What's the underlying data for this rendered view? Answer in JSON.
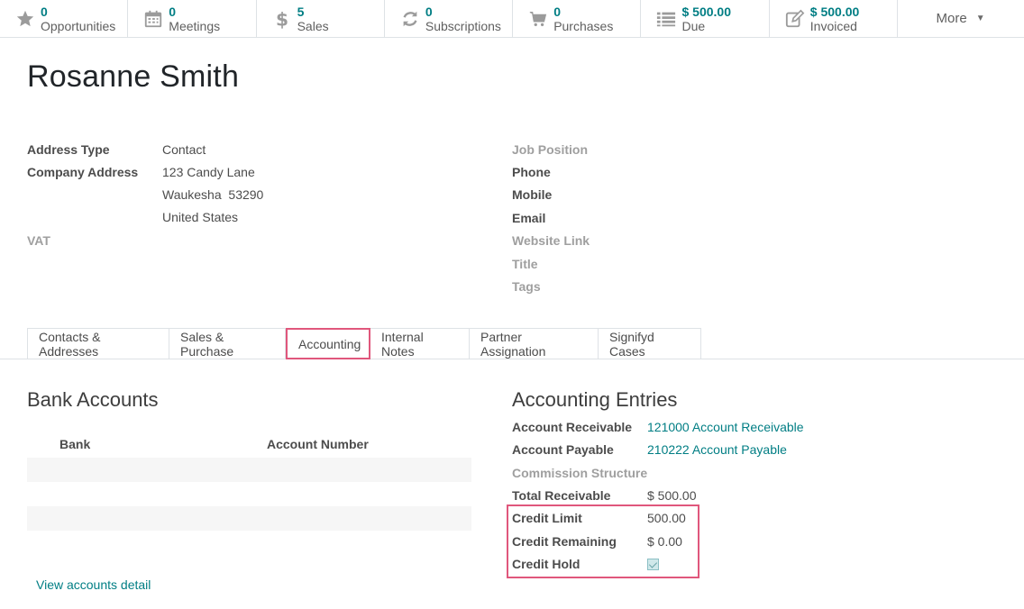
{
  "smart_buttons": [
    {
      "icon": "star-icon",
      "value": "0",
      "label": "Opportunities"
    },
    {
      "icon": "calendar-icon",
      "value": "0",
      "label": "Meetings"
    },
    {
      "icon": "dollar-icon",
      "value": "5",
      "label": "Sales"
    },
    {
      "icon": "refresh-icon",
      "value": "0",
      "label": "Subscriptions"
    },
    {
      "icon": "cart-icon",
      "value": "0",
      "label": "Purchases"
    },
    {
      "icon": "list-icon",
      "value": "$ 500.00",
      "label": "Due"
    },
    {
      "icon": "edit-icon",
      "value": "$ 500.00",
      "label": "Invoiced"
    }
  ],
  "more_label": "More",
  "partner_name": "Rosanne Smith",
  "left_fields": {
    "address_type_label": "Address Type",
    "address_type_value": "Contact",
    "company_address_label": "Company Address",
    "street": "123 Candy Lane",
    "city_zip": "Waukesha  53290",
    "country": "United States",
    "vat_label": "VAT"
  },
  "right_fields": {
    "job_position": "Job Position",
    "phone": "Phone",
    "mobile": "Mobile",
    "email": "Email",
    "website": "Website Link",
    "title": "Title",
    "tags": "Tags"
  },
  "tabs": [
    {
      "label": "Contacts & Addresses"
    },
    {
      "label": "Sales & Purchase"
    },
    {
      "label": "Accounting"
    },
    {
      "label": "Internal Notes"
    },
    {
      "label": "Partner Assignation"
    },
    {
      "label": "Signifyd Cases"
    }
  ],
  "bank_accounts": {
    "title": "Bank Accounts",
    "col_bank": "Bank",
    "col_account_number": "Account Number",
    "view_detail": "View accounts detail"
  },
  "accounting_entries": {
    "title": "Accounting Entries",
    "account_receivable_label": "Account Receivable",
    "account_receivable_value": "121000 Account Receivable",
    "account_payable_label": "Account Payable",
    "account_payable_value": "210222 Account Payable",
    "commission_label": "Commission Structure",
    "total_receivable_label": "Total Receivable",
    "total_receivable_value": "$ 500.00",
    "credit_limit_label": "Credit Limit",
    "credit_limit_value": "500.00",
    "credit_remaining_label": "Credit Remaining",
    "credit_remaining_value": "$ 0.00",
    "credit_hold_label": "Credit Hold",
    "credit_hold_checked": true
  },
  "colors": {
    "accent": "#017e84",
    "highlight": "#e0577c"
  }
}
